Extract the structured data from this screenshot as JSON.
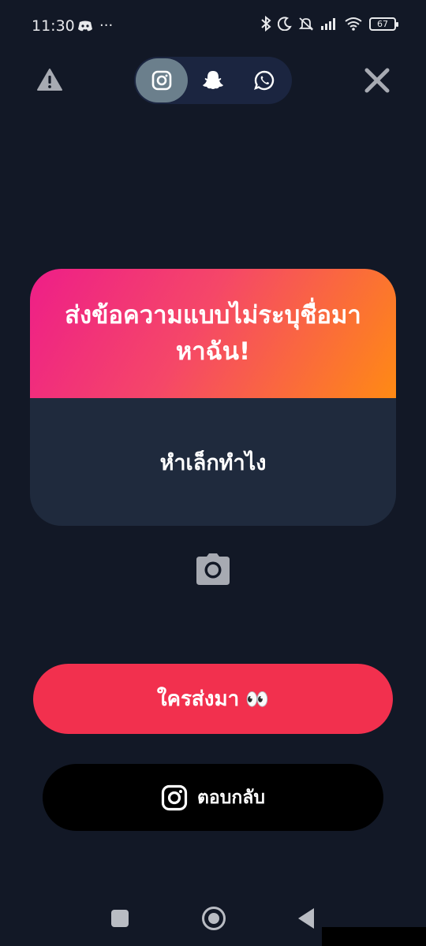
{
  "status_bar": {
    "time": "11:30",
    "more": "···",
    "battery": "67",
    "icons": [
      "discord-icon",
      "bluetooth-icon",
      "moon-icon",
      "mute-icon",
      "signal-icon",
      "wifi-icon",
      "battery-icon"
    ]
  },
  "top_bar": {
    "left_icon": "warning-icon",
    "right_icon": "close-icon",
    "platforms": [
      {
        "icon": "instagram-icon",
        "active": true
      },
      {
        "icon": "snapchat-icon",
        "active": false
      },
      {
        "icon": "whatsapp-icon",
        "active": false
      }
    ]
  },
  "card": {
    "title": "ส่งข้อความแบบไม่ระบุชื่อมา หาฉัน!",
    "message": "หำเล็กทำไง",
    "gradient": [
      "#ee1e88",
      "#f54768",
      "#ff8a14"
    ],
    "body_color": "#1f2a3d"
  },
  "camera": {
    "icon": "camera-icon"
  },
  "primary_button": {
    "label": "ใครส่งมา",
    "emoji": "👀",
    "color": "#f2304e"
  },
  "secondary_button": {
    "label": "ตอบกลับ",
    "icon": "instagram-icon",
    "color": "#000000"
  },
  "nav_bar": {
    "icons": [
      "recents-icon",
      "home-icon",
      "back-icon"
    ]
  },
  "colors": {
    "background": "#121826",
    "switch_bg": "#1b2540",
    "active_tab": "#6b7f8c"
  }
}
